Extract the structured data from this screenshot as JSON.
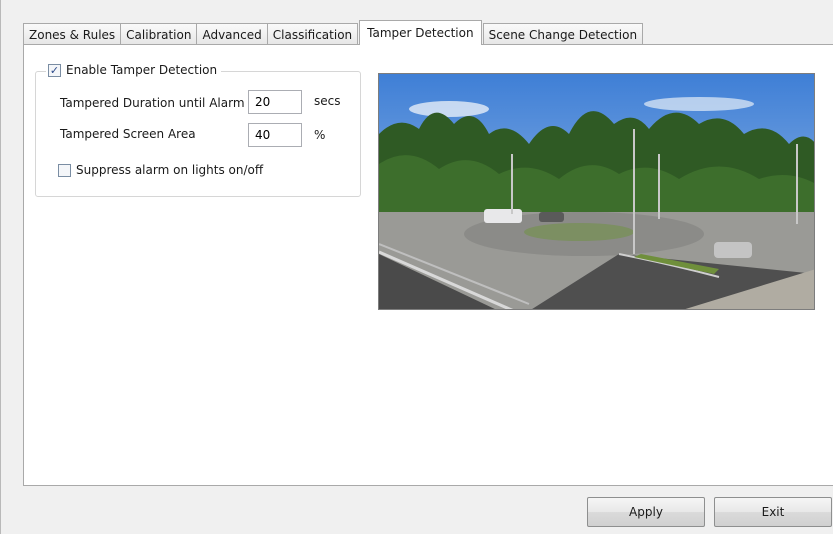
{
  "tabs": [
    {
      "label": "Zones & Rules"
    },
    {
      "label": "Calibration"
    },
    {
      "label": "Advanced"
    },
    {
      "label": "Classification"
    },
    {
      "label": "Tamper Detection"
    },
    {
      "label": "Scene Change Detection"
    }
  ],
  "active_tab": "Tamper Detection",
  "tamper": {
    "enable_label": "Enable Tamper Detection",
    "enable_checked": "✓",
    "duration_label": "Tampered Duration until Alarm",
    "duration_value": "20",
    "duration_unit": "secs",
    "area_label": "Tampered Screen Area",
    "area_value": "40",
    "area_unit": "%",
    "suppress_label": "Suppress alarm on lights on/off",
    "suppress_checked": ""
  },
  "buttons": {
    "apply": "Apply",
    "exit": "Exit"
  },
  "colors": {
    "panel_bg": "#ffffff",
    "window_bg": "#f0f0f0",
    "checkbox_mark": "#2c4a8a"
  }
}
